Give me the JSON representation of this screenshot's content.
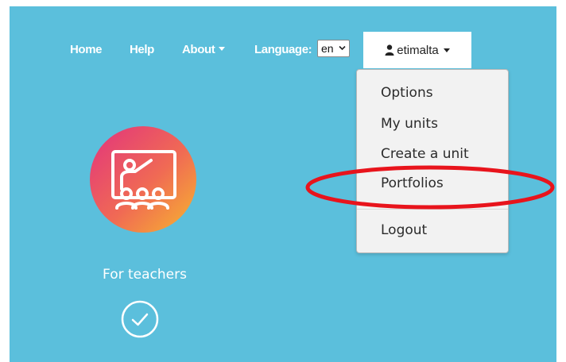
{
  "nav": {
    "home": "Home",
    "help": "Help",
    "about": "About",
    "language_label": "Language:",
    "language_value": "en"
  },
  "user_menu": {
    "username": "etimalta",
    "items": [
      "Options",
      "My units",
      "Create a unit",
      "Portfolios",
      "Logout"
    ],
    "highlighted": "Portfolios"
  },
  "tile": {
    "label": "For teachers",
    "selected": true
  },
  "colors": {
    "background": "#5bbfdc",
    "highlight_ring": "#e8141c"
  }
}
